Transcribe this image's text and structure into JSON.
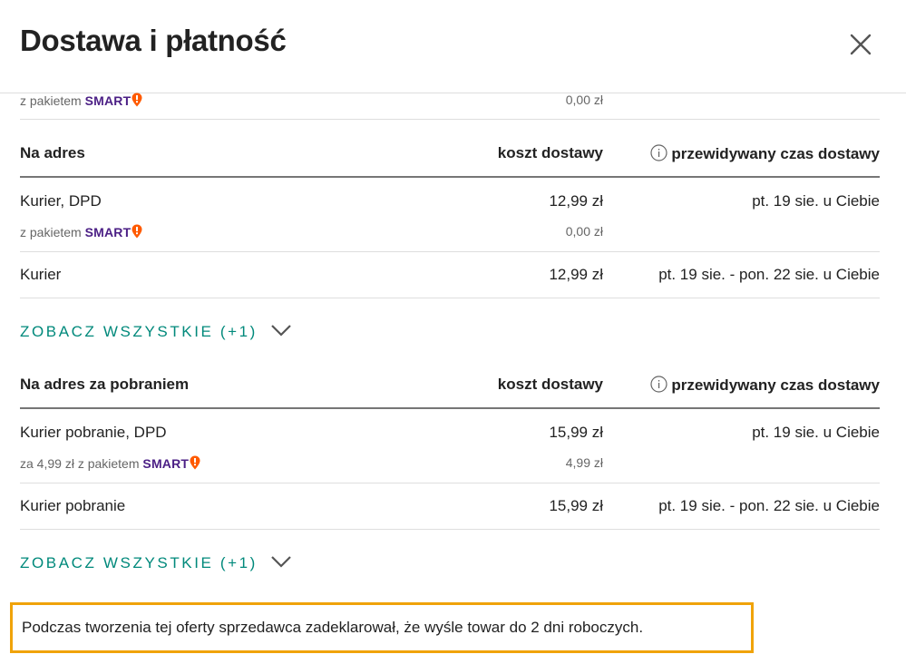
{
  "dialog": {
    "title": "Dostawa i płatność"
  },
  "top_partial": {
    "smart_prefix": "z pakietem",
    "smart_brand": "SMART",
    "cost": "0,00 zł"
  },
  "sections": [
    {
      "header": "Na adres",
      "cost_header": "koszt dostawy",
      "time_header": "przewidywany czas dostawy",
      "options": [
        {
          "name": "Kurier, DPD",
          "cost": "12,99 zł",
          "time": "pt. 19 sie. u Ciebie",
          "smart_prefix": "z pakietem",
          "smart_brand": "SMART",
          "smart_cost": "0,00 zł"
        },
        {
          "name": "Kurier",
          "cost": "12,99 zł",
          "time": "pt. 19 sie. - pon. 22 sie. u Ciebie"
        }
      ],
      "see_all": "ZOBACZ WSZYSTKIE (+1)"
    },
    {
      "header": "Na adres za pobraniem",
      "cost_header": "koszt dostawy",
      "time_header": "przewidywany czas dostawy",
      "options": [
        {
          "name": "Kurier pobranie, DPD",
          "cost": "15,99 zł",
          "time": "pt. 19 sie. u Ciebie",
          "smart_prefix": "za 4,99 zł z pakietem",
          "smart_brand": "SMART",
          "smart_cost": "4,99 zł"
        },
        {
          "name": "Kurier pobranie",
          "cost": "15,99 zł",
          "time": "pt. 19 sie. - pon. 22 sie. u Ciebie"
        }
      ],
      "see_all": "ZOBACZ WSZYSTKIE (+1)"
    }
  ],
  "note": "Podczas tworzenia tej oferty sprzedawca zadeklarował, że wyśle towar do 2 dni roboczych.",
  "colors": {
    "accent_link": "#00897b",
    "smart_purple": "#4b1f85",
    "smart_orange": "#ff5a00",
    "note_border": "#f0a30a"
  },
  "icons": {
    "close": "close-icon",
    "info": "info-icon",
    "chevron": "chevron-down-icon",
    "smart_badge": "smart-pin-icon"
  }
}
